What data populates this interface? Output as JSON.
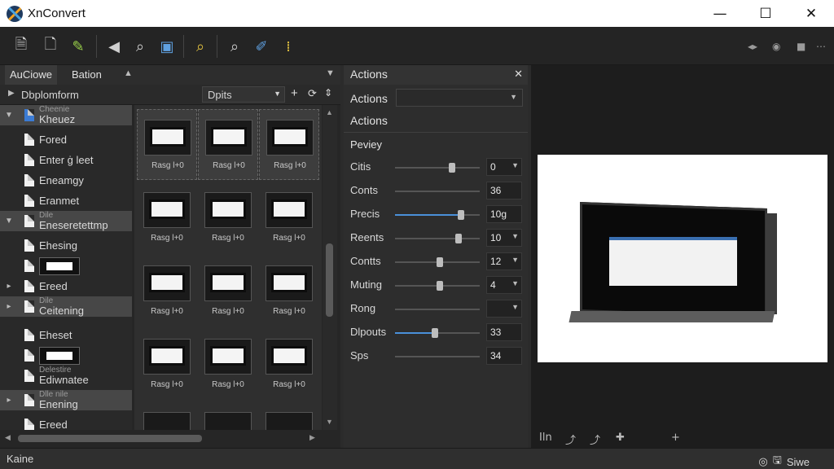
{
  "window": {
    "title": "XnConvert",
    "minimize": "—",
    "maximize": "☐",
    "close": "✕"
  },
  "toolbar": {
    "icons": [
      "new-file-icon",
      "open-file-icon",
      "brush-icon",
      "speaker-icon",
      "search-icon",
      "image-tool-icon",
      "zoom-icon",
      "search-icon",
      "edit-pen-icon",
      "grid-select-icon"
    ],
    "right_icons": [
      "arrows-icon",
      "eye-icon",
      "square-icon",
      "dots-icon"
    ]
  },
  "left": {
    "tab1": "AuCiowe",
    "tab2": "Bation",
    "tab_arrow": "▲",
    "tab_more": "▼",
    "subbar_left": "Dbplomform",
    "subbar_select": "Dpits",
    "tree": [
      {
        "label": "Kheuez",
        "small": "Cheenie",
        "selected": true,
        "icon": "blue"
      },
      {
        "label": "Fored"
      },
      {
        "label": "Enter ġ leet"
      },
      {
        "label": "Eneamgy"
      },
      {
        "label": "Eranmet"
      },
      {
        "label": "Eneseretettmp",
        "small": "Dile",
        "selected": true
      },
      {
        "label": "Ehesing"
      },
      {
        "label": ""
      },
      {
        "label": "Ereed"
      },
      {
        "label": "Ceitening",
        "small": "Dile",
        "selected": true
      },
      {
        "label": "Eheset"
      },
      {
        "label": ""
      },
      {
        "label": "Ediwnatee",
        "small": "Delestire"
      },
      {
        "label": "Enening",
        "small": "Dlle nile",
        "selected": true
      },
      {
        "label": "Ereed"
      }
    ],
    "captions": [
      "Rasg l+0",
      "Rasg l+0",
      "Rasg l+0",
      "Rasg l+0",
      "Rasg l+0",
      "Rasg l+0",
      "Rasg l+0",
      "Rasg l+0",
      "Rasg l+0",
      "Rasg l+0",
      "Rasg l+0",
      "Rasg l+0"
    ]
  },
  "actions": {
    "header": "Actions",
    "row1": "Actions",
    "row2": "Actions",
    "section": "Peviey",
    "props": [
      {
        "label": "Citis",
        "value": "0",
        "level": 0.67,
        "dropdown": true,
        "fill": false
      },
      {
        "label": "Conts",
        "value": "36",
        "level": null,
        "dropdown": false,
        "fill": false
      },
      {
        "label": "Precis",
        "value": "10g",
        "level": 0.78,
        "dropdown": false,
        "fill": true
      },
      {
        "label": "Reents",
        "value": "10",
        "level": 0.75,
        "dropdown": true,
        "fill": false
      },
      {
        "label": "Contts",
        "value": "12",
        "level": 0.53,
        "dropdown": true,
        "fill": false
      },
      {
        "label": "Muting",
        "value": "4",
        "level": 0.53,
        "dropdown": true,
        "fill": false
      },
      {
        "label": "Rong",
        "value": "",
        "level": null,
        "dropdown": true,
        "fill": false
      },
      {
        "label": "Dlpouts",
        "value": "33",
        "level": 0.47,
        "dropdown": false,
        "fill": true
      },
      {
        "label": "Sps",
        "value": "34",
        "level": null,
        "dropdown": false,
        "fill": false
      }
    ]
  },
  "preview": {
    "tools": [
      "Iln",
      "⤴",
      "⤴",
      "✚",
      "+"
    ]
  },
  "status": {
    "left": "Kaine",
    "right": "Siwe"
  }
}
